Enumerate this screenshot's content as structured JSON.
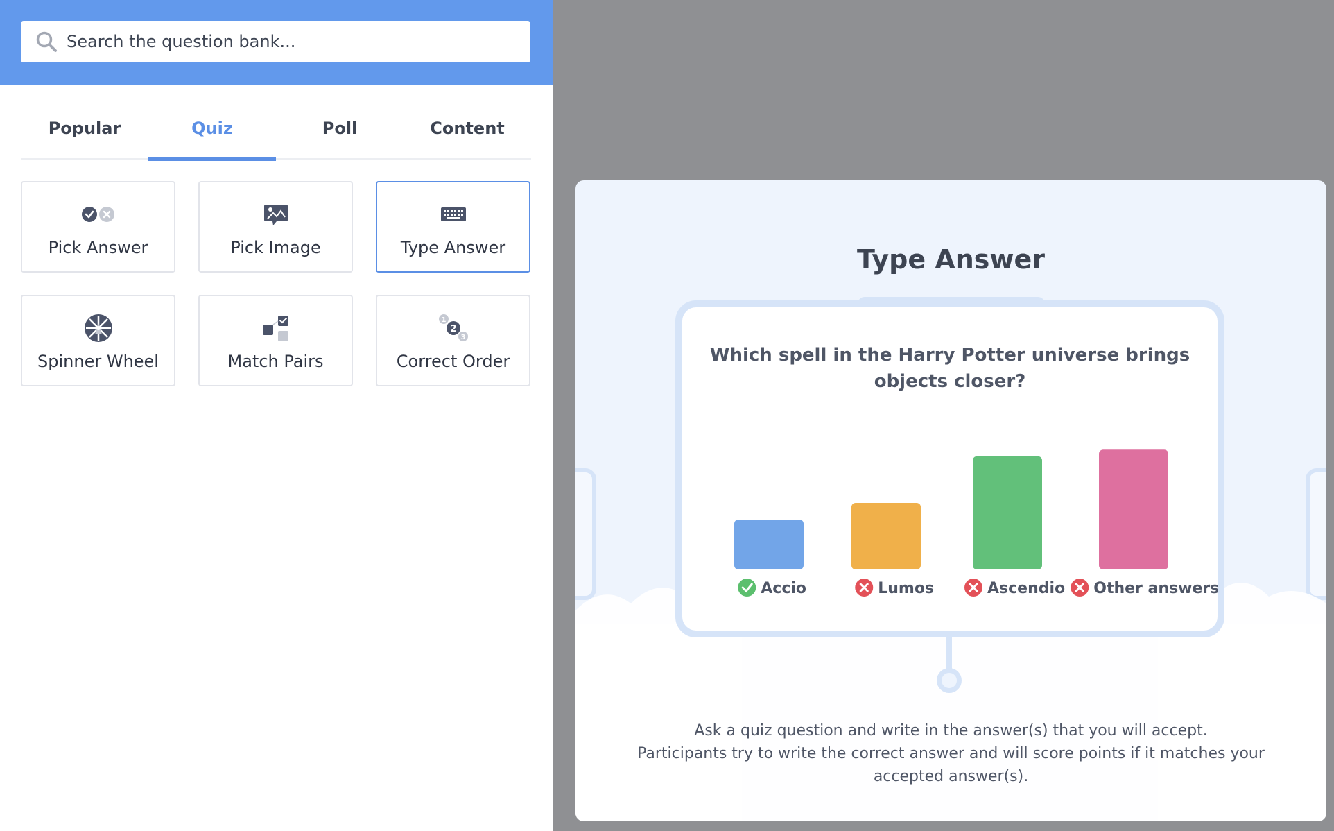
{
  "search": {
    "placeholder": "Search the question bank..."
  },
  "tabs": [
    {
      "label": "Popular"
    },
    {
      "label": "Quiz",
      "active": true
    },
    {
      "label": "Poll"
    },
    {
      "label": "Content"
    }
  ],
  "cards": [
    {
      "label": "Pick Answer",
      "icon": "check-x-icon"
    },
    {
      "label": "Pick Image",
      "icon": "image-icon"
    },
    {
      "label": "Type Answer",
      "icon": "keyboard-icon",
      "selected": true
    },
    {
      "label": "Spinner Wheel",
      "icon": "wheel-icon"
    },
    {
      "label": "Match Pairs",
      "icon": "match-pairs-icon"
    },
    {
      "label": "Correct Order",
      "icon": "order-icon"
    }
  ],
  "preview": {
    "title": "Type Answer",
    "question": "Which spell in the Harry Potter universe brings objects closer?",
    "description_line1": "Ask a quiz question and write in the answer(s) that you will accept.",
    "description_line2": "Participants try to write the correct answer and will score points if it matches your accepted answer(s)."
  },
  "chart_data": {
    "type": "bar",
    "categories": [
      "Accio",
      "Lumos",
      "Ascendio",
      "Other answers"
    ],
    "values": [
      30,
      40,
      68,
      72
    ],
    "correct": [
      true,
      false,
      false,
      false
    ],
    "colors": [
      "#72a5e8",
      "#f0b04a",
      "#62c07a",
      "#de709f"
    ],
    "correct_color": "#5cbf6e",
    "wrong_color": "#e35158",
    "title": "",
    "xlabel": "",
    "ylabel": ""
  }
}
